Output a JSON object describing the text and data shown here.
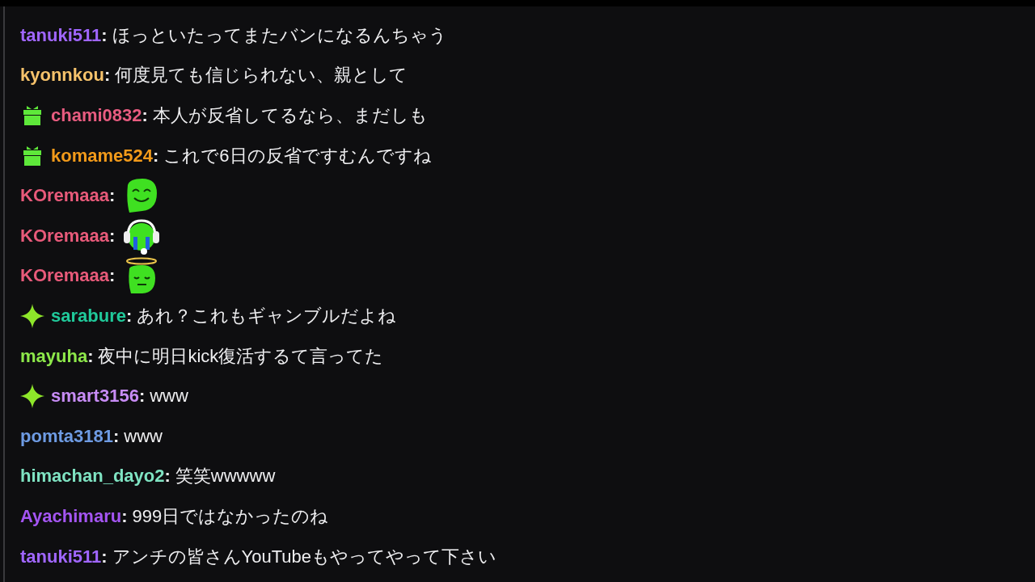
{
  "messages": [
    {
      "user": "tanuki511",
      "separator": ":",
      "color": "#a066ff",
      "text": "ほっといたってまたバンになるんちゃう"
    },
    {
      "user": "kyonnkou",
      "separator": ":",
      "color": "#f5c26b",
      "text": "何度見ても信じられない、親として"
    },
    {
      "badge": {
        "kind": "gift"
      },
      "user": "chami0832",
      "separator": ":",
      "color": "#e85c80",
      "text": "本人が反省してるなら、まだしも"
    },
    {
      "badge": {
        "kind": "gift"
      },
      "user": "komame524",
      "separator": ":",
      "color": "#f29a1a",
      "text": "これで6日の反省ですむんですね"
    },
    {
      "user": "KOremaaa",
      "separator": ":",
      "color": "#e85a7a",
      "emote": {
        "kind": "smile"
      }
    },
    {
      "user": "KOremaaa",
      "separator": ":",
      "color": "#e85a7a",
      "emote": {
        "kind": "crying"
      }
    },
    {
      "user": "KOremaaa",
      "separator": ":",
      "color": "#e85a7a",
      "emote": {
        "kind": "halo"
      }
    },
    {
      "badge": {
        "kind": "sparkle"
      },
      "user": "sarabure",
      "separator": ":",
      "color": "#20c99a",
      "text": "あれ？これもギャンブルだよね"
    },
    {
      "user": "mayuha",
      "separator": ":",
      "color": "#8de84a",
      "text": "夜中に明日kick復活するて言ってた"
    },
    {
      "badge": {
        "kind": "sparkle"
      },
      "user": "smart3156",
      "separator": ":",
      "color": "#c78cf5",
      "text": "www"
    },
    {
      "user": "pomta3181",
      "separator": ":",
      "color": "#6e9be3",
      "text": "www"
    },
    {
      "user": "himachan_dayo2",
      "separator": ":",
      "color": "#7fe3c2",
      "text": "笑笑wwwww"
    },
    {
      "user": "Ayachimaru",
      "separator": ":",
      "color": "#a455f2",
      "text": "999日ではなかったのね"
    },
    {
      "user": "tanuki511",
      "separator": ":",
      "color": "#a066ff",
      "text": "アンチの皆さんYouTubeもやってやって下さい"
    }
  ]
}
